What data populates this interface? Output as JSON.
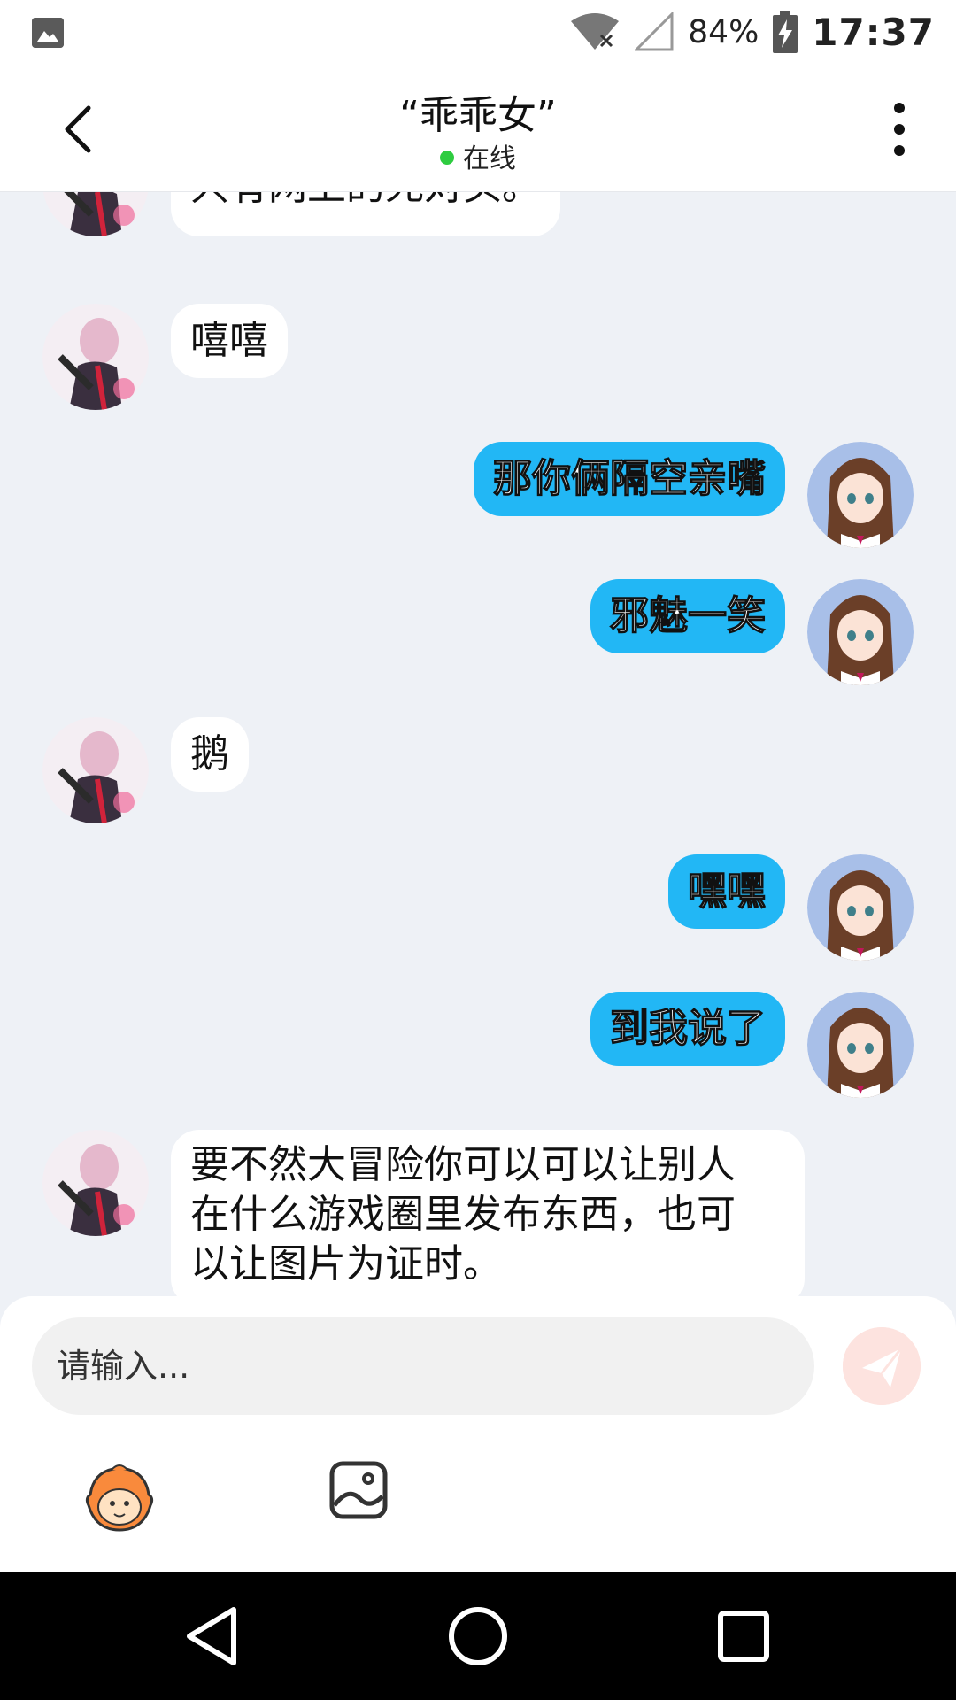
{
  "status_bar": {
    "battery": "84%",
    "time": "17:37",
    "icons": [
      "gallery-notification-icon",
      "wifi-off-icon",
      "signal-icon",
      "battery-charging-icon"
    ]
  },
  "header": {
    "title": "“乖乖女”",
    "status": "在线",
    "status_color": "#2ecc40",
    "icons": [
      "back-icon",
      "more-vert-icon"
    ]
  },
  "messages": [
    {
      "side": "in",
      "text": "只有网上的死对头。"
    },
    {
      "side": "in",
      "text": "嘻嘻"
    },
    {
      "side": "out",
      "text": "那你俩隔空亲嘴"
    },
    {
      "side": "out",
      "text": "邪魅一笑"
    },
    {
      "side": "in",
      "text": "鹅"
    },
    {
      "side": "out",
      "text": "嘿嘿"
    },
    {
      "side": "out",
      "text": "到我说了"
    },
    {
      "side": "in",
      "text": "要不然大冒险你可以可以让别人\n在什么游戏圈里发布东西，也可\n以让图片为证时。"
    }
  ],
  "composer": {
    "placeholder": "请输入...",
    "icons": [
      "send-icon",
      "emoji-icon",
      "image-icon"
    ],
    "send_color": "#f7b3a8"
  },
  "nav": {
    "icons": [
      "nav-back-icon",
      "nav-home-icon",
      "nav-recents-icon"
    ]
  },
  "colors": {
    "outgoing_bubble": "#22b7f5",
    "incoming_bubble": "#ffffff",
    "chat_background": "#eef1f6"
  }
}
